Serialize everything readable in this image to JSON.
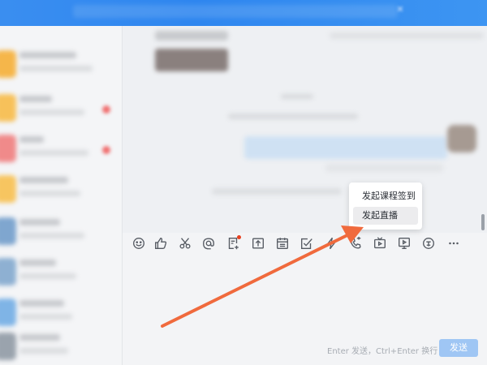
{
  "popup_menu": {
    "items": [
      {
        "label": "发起课程签到",
        "highlighted": false
      },
      {
        "label": "发起直播",
        "highlighted": true
      }
    ]
  },
  "toolbar": {
    "icons": [
      "emoji-icon",
      "thumbs-up-icon",
      "scissors-icon",
      "at-icon",
      "document-add-icon",
      "upload-icon",
      "calendar-icon",
      "task-check-icon",
      "lightning-icon",
      "phone-call-icon",
      "tv-icon",
      "video-play-icon",
      "school-badge-icon",
      "more-icon"
    ]
  },
  "input": {
    "hint": "Enter 发送，Ctrl+Enter 换行",
    "send_label": "发送"
  },
  "colors": {
    "topbar": "#2e86ef",
    "accent_arrow": "#f06a3d",
    "send_button": "#9fc6f4"
  }
}
